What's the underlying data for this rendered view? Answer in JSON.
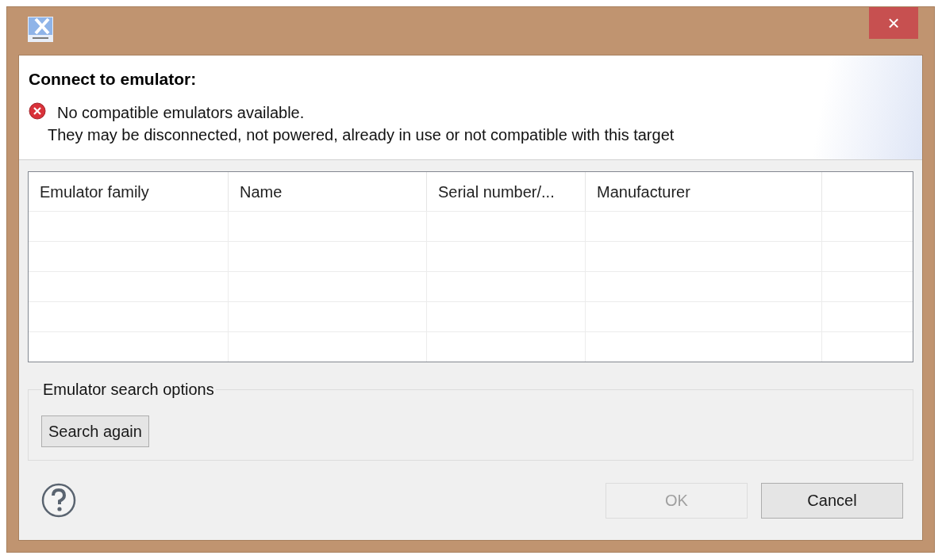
{
  "window": {
    "title_bar_close": "×"
  },
  "header": {
    "title": "Connect to emulator:",
    "message": {
      "error": true,
      "lines": [
        "No compatible emulators available.",
        "They may be disconnected, not powered, already in use or not compatible with this target"
      ]
    }
  },
  "table": {
    "columns": [
      "Emulator family",
      "Name",
      "Serial number/...",
      "Manufacturer"
    ]
  },
  "search_options": {
    "title": "Emulator search options",
    "button": {
      "label": "Search again",
      "disabled": false
    }
  },
  "buttons": [
    {
      "label": "OK",
      "disabled": true
    },
    {
      "label": "Cancel",
      "disabled": false
    }
  ]
}
